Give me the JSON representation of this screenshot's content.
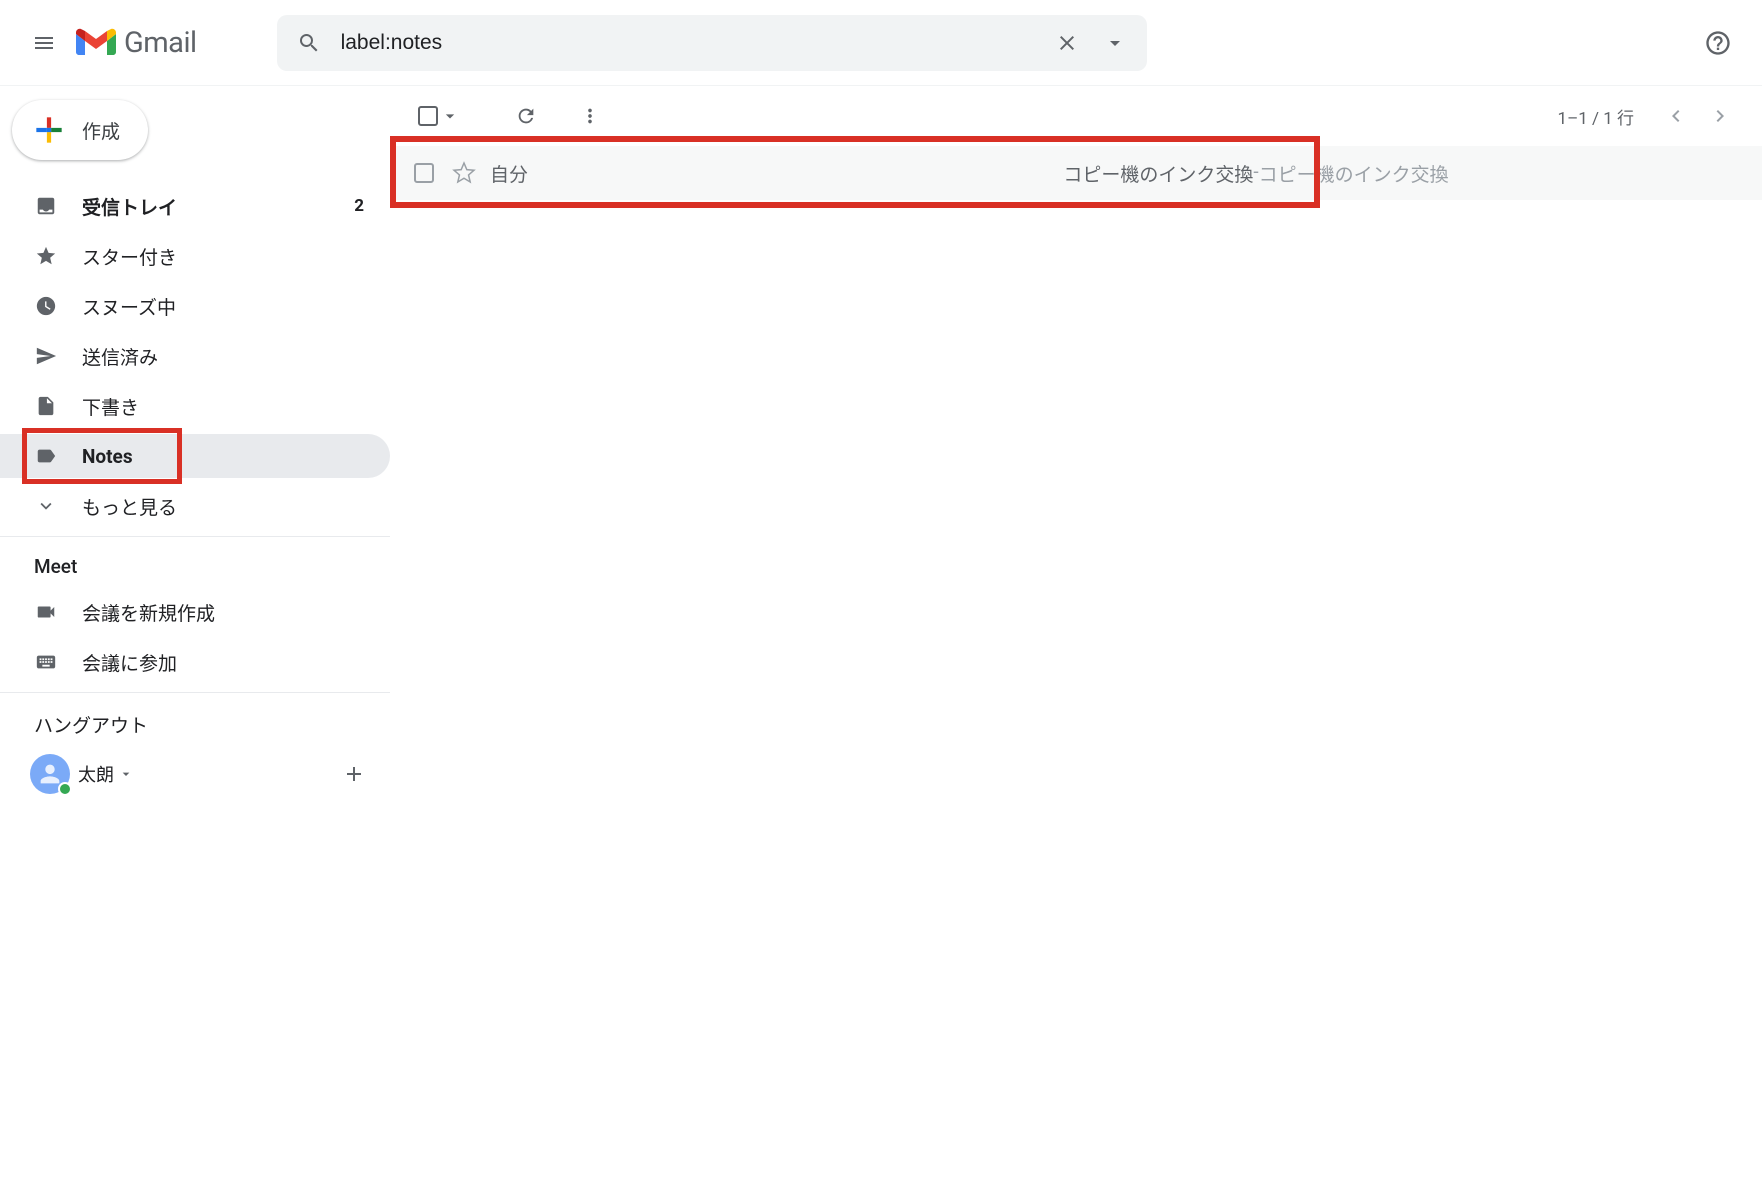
{
  "header": {
    "app_name": "Gmail",
    "search_value": "label:notes"
  },
  "sidebar": {
    "compose_label": "作成",
    "items": [
      {
        "label": "受信トレイ",
        "count": "2",
        "bold": true,
        "icon": "inbox"
      },
      {
        "label": "スター付き",
        "icon": "star"
      },
      {
        "label": "スヌーズ中",
        "icon": "clock"
      },
      {
        "label": "送信済み",
        "icon": "send"
      },
      {
        "label": "下書き",
        "icon": "draft"
      },
      {
        "label": "Notes",
        "icon": "label",
        "active": true
      },
      {
        "label": "もっと見る",
        "icon": "expand"
      }
    ],
    "meet_title": "Meet",
    "meet_items": [
      {
        "label": "会議を新規作成",
        "icon": "video"
      },
      {
        "label": "会議に参加",
        "icon": "keyboard"
      }
    ],
    "hangouts_title": "ハングアウト",
    "hangouts_user": "太朗"
  },
  "toolbar": {
    "page_info": "1–1 / 1 行"
  },
  "emails": [
    {
      "sender": "自分",
      "subject": "コピー機のインク交換",
      "snippet_prefix": " - ",
      "snippet": "コピー機のインク交換"
    }
  ]
}
